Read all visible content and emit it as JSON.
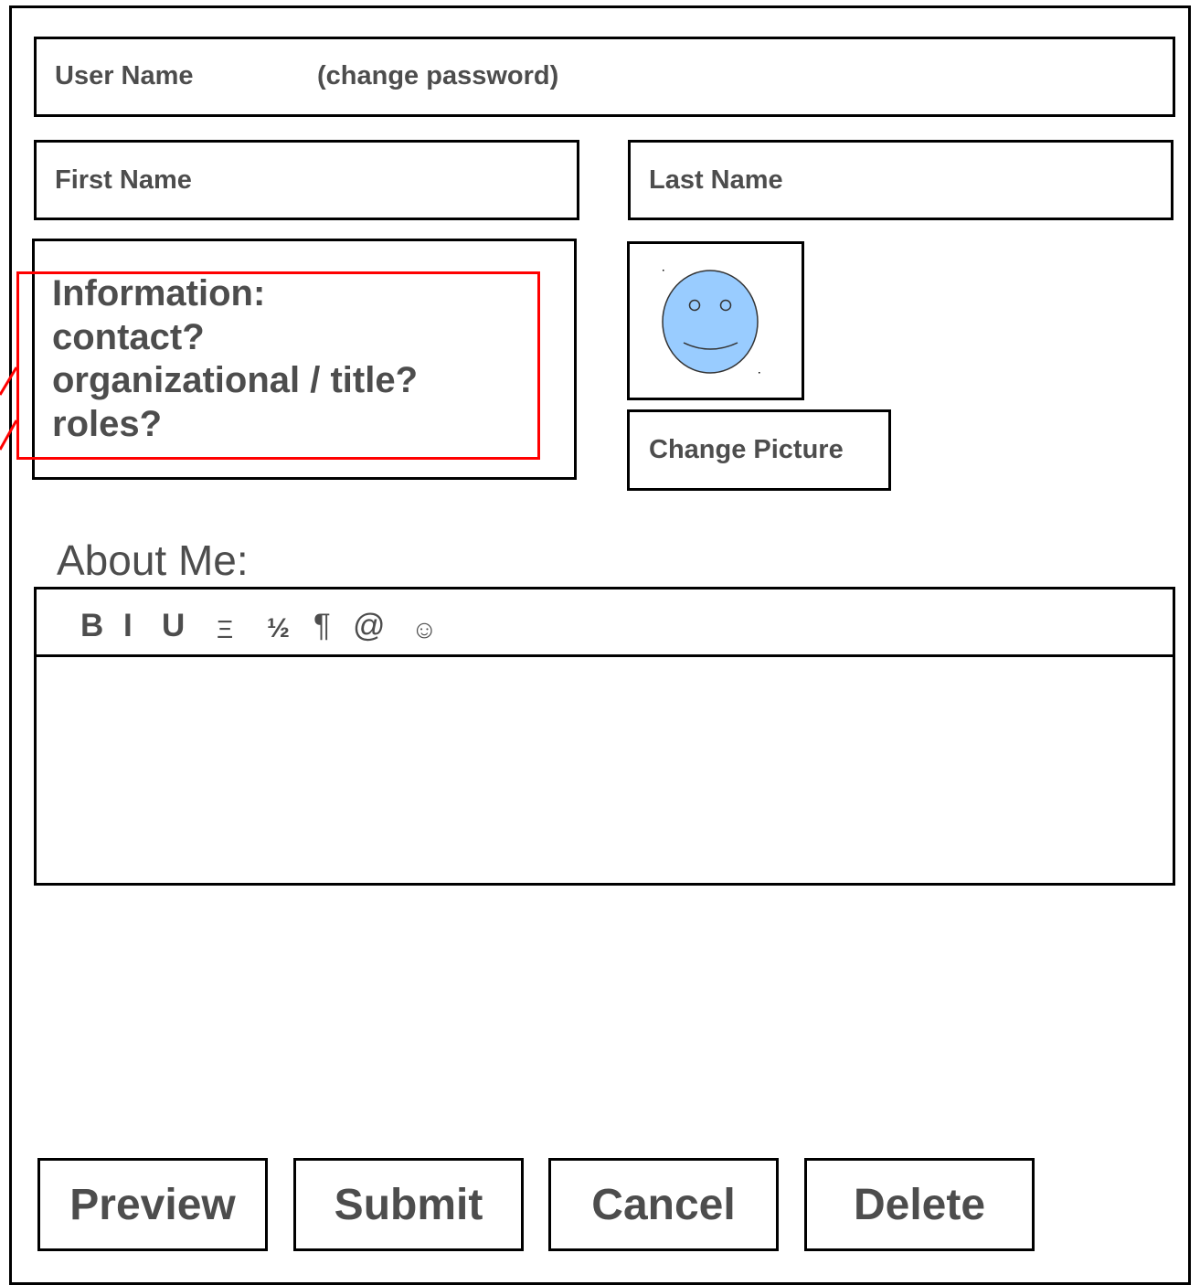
{
  "form": {
    "user_name_label": "User Name",
    "change_password_link": "(change password)",
    "first_name_label": "First Name",
    "last_name_label": "Last Name",
    "info": {
      "lines": [
        "Information:",
        "contact?",
        "organizational / title?",
        "roles?"
      ]
    },
    "avatar": {
      "icon": "smiley-face-icon",
      "fill_color": "#99ccff"
    },
    "change_picture_label": "Change Picture",
    "about_me_label": "About Me:",
    "editor": {
      "toolbar": {
        "bold": "B",
        "italic": "I",
        "underline": "U",
        "list": "Ξ",
        "fraction": "½",
        "paragraph": "¶",
        "mention": "@",
        "emoji": "☺"
      },
      "content": ""
    },
    "actions": {
      "preview": "Preview",
      "submit": "Submit",
      "cancel": "Cancel",
      "delete": "Delete"
    }
  },
  "colors": {
    "annotation": "#ff0000",
    "text": "#4d4d4d",
    "border": "#000000"
  }
}
